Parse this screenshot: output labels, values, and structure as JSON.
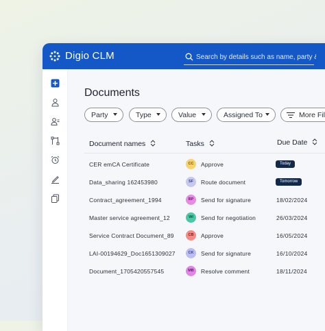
{
  "app": {
    "title": "Digio CLM"
  },
  "search": {
    "placeholder": "Search by details such as name, party & type"
  },
  "page": {
    "title": "Documents"
  },
  "filters": [
    {
      "label": "Party"
    },
    {
      "label": "Type"
    },
    {
      "label": "Value"
    },
    {
      "label": "Assigned To"
    },
    {
      "label": "More Fil"
    }
  ],
  "table": {
    "headers": [
      "Document names",
      "Tasks",
      "Due Date"
    ],
    "rows": [
      {
        "doc": "CER emCA Certificate",
        "initials": "CC",
        "task": "Approve",
        "due": "Today",
        "avatar_bg": "#f7d36b",
        "avatar_fg": "#6b5410"
      },
      {
        "doc": "Data_sharing 162453980",
        "initials": "SF",
        "task": "Route document",
        "due": "Tomorrow",
        "avatar_bg": "#c6c8f0",
        "avatar_fg": "#3d3f8a"
      },
      {
        "doc": "Contract_agreement_1994",
        "initials": "BP",
        "task": "Send for signature",
        "due": "18/02/2024",
        "avatar_bg": "#e58be3",
        "avatar_fg": "#6a1f68"
      },
      {
        "doc": "Master service agreement_12",
        "initials": "WI",
        "task": "Send for negotiation",
        "due": "26/03/2024",
        "avatar_bg": "#49c7a7",
        "avatar_fg": "#0f4f40"
      },
      {
        "doc": "Service Contract Document_89",
        "initials": "CB",
        "task": "Approve",
        "due": "16/05/2024",
        "avatar_bg": "#f48b85",
        "avatar_fg": "#6e211c"
      },
      {
        "doc": "LAI-00194629_Doc1651309027",
        "initials": "CK",
        "task": "Send for signature",
        "due": "16/10/2024",
        "avatar_bg": "#b9bdf2",
        "avatar_fg": "#363b8c"
      },
      {
        "doc": "Document_1705420557545",
        "initials": "MB",
        "task": "Resolve comment",
        "due": "18/11/2024",
        "avatar_bg": "#de86e6",
        "avatar_fg": "#5f1c66"
      }
    ]
  },
  "colors": {
    "brand": "#1458c8",
    "badge": "#12294a"
  },
  "icons": {
    "logo": "grid-dots-icon",
    "search": "search-icon",
    "sidebar": [
      "add-icon",
      "user-icon",
      "user-group-icon",
      "workflow-icon",
      "alarm-clock-icon",
      "pen-icon",
      "copy-icon"
    ]
  }
}
